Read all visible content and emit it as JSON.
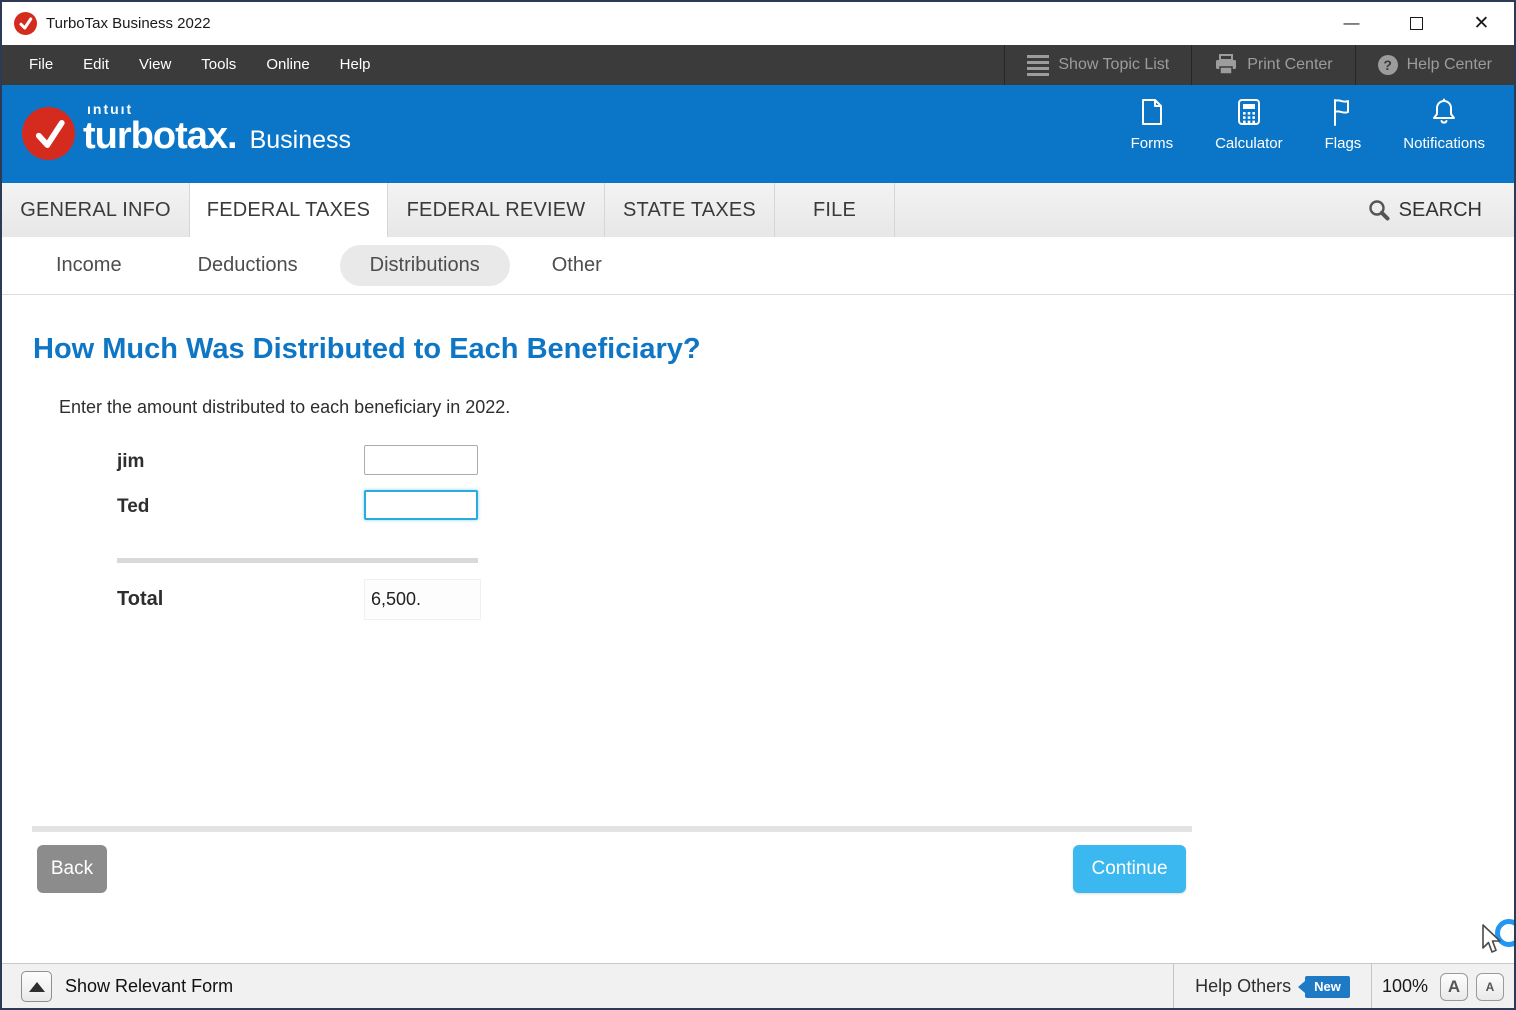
{
  "window": {
    "title": "TurboTax Business 2022",
    "minimize_glyph": "—",
    "close_glyph": "✕"
  },
  "menubar": {
    "items": [
      "File",
      "Edit",
      "View",
      "Tools",
      "Online",
      "Help"
    ],
    "actions": [
      {
        "label": "Show Topic List",
        "icon": "topic-list-icon"
      },
      {
        "label": "Print Center",
        "icon": "printer-icon"
      },
      {
        "label": "Help Center",
        "icon": "help-icon",
        "glyph": "?"
      }
    ]
  },
  "header": {
    "brand": {
      "intuit": "ıntuıt",
      "product": "turbotax.",
      "edition": "Business"
    },
    "tools": [
      {
        "label": "Forms",
        "icon": "document-icon"
      },
      {
        "label": "Calculator",
        "icon": "calculator-icon"
      },
      {
        "label": "Flags",
        "icon": "flag-icon"
      },
      {
        "label": "Notifications",
        "icon": "bell-icon"
      }
    ]
  },
  "tabs": {
    "items": [
      {
        "label": "GENERAL INFO",
        "active": false
      },
      {
        "label": "FEDERAL TAXES",
        "active": true
      },
      {
        "label": "FEDERAL REVIEW",
        "active": false
      },
      {
        "label": "STATE TAXES",
        "active": false
      },
      {
        "label": "FILE",
        "active": false
      }
    ],
    "search_label": "SEARCH"
  },
  "subnav": {
    "items": [
      "Income",
      "Deductions",
      "Distributions",
      "Other"
    ],
    "selected": "Distributions"
  },
  "content": {
    "heading": "How Much Was Distributed to Each Beneficiary?",
    "instruction": "Enter the amount distributed to each beneficiary in 2022.",
    "rows": [
      {
        "label": "jim",
        "value": ""
      },
      {
        "label": "Ted",
        "value": ""
      }
    ],
    "total_label": "Total",
    "total_value": "6,500."
  },
  "footer": {
    "back_label": "Back",
    "continue_label": "Continue"
  },
  "statusbar": {
    "show_relevant_form": "Show Relevant Form",
    "help_others": "Help Others",
    "new_badge": "New",
    "zoom_level": "100%",
    "font_large": "A",
    "font_small": "A"
  },
  "colors": {
    "brand_blue": "#0b76c8",
    "continue_blue": "#3cb8f0",
    "focus_blue": "#29abe2",
    "heading_blue": "#0e76c4",
    "logo_red": "#d52b1e",
    "menubar_dark": "#3b3b3b",
    "new_badge_blue": "#1f7ac6",
    "spinner_blue": "#2196f3"
  }
}
